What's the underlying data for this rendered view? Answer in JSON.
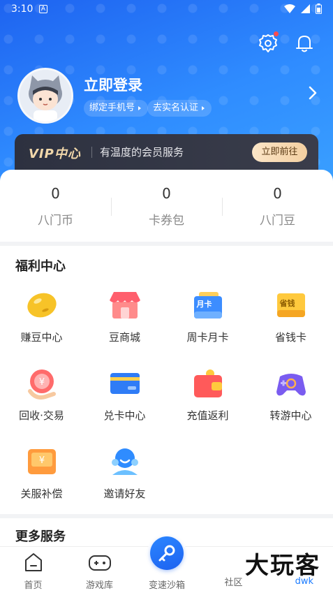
{
  "status_bar": {
    "time": "3:10",
    "a_badge": "A"
  },
  "header": {
    "login_title": "立即登录",
    "bind_phone": "绑定手机号",
    "verify_name": "去实名认证"
  },
  "vip": {
    "logo": "VIP中心",
    "slogan": "有温度的会员服务",
    "button": "立即前往"
  },
  "assets": [
    {
      "value": "0",
      "label": "八门币"
    },
    {
      "value": "0",
      "label": "卡券包"
    },
    {
      "value": "0",
      "label": "八门豆"
    }
  ],
  "welfare": {
    "title": "福利中心",
    "items": [
      {
        "label": "赚豆中心",
        "icon": "bean-icon"
      },
      {
        "label": "豆商城",
        "icon": "shop-icon"
      },
      {
        "label": "周卡月卡",
        "icon": "month-card-icon",
        "badge": "月卡"
      },
      {
        "label": "省钱卡",
        "icon": "save-card-icon",
        "badge": "省钱"
      },
      {
        "label": "回收·交易",
        "icon": "recycle-trade-icon"
      },
      {
        "label": "兑卡中心",
        "icon": "card-exchange-icon"
      },
      {
        "label": "充值返利",
        "icon": "wallet-icon"
      },
      {
        "label": "转游中心",
        "icon": "gamepad-icon"
      },
      {
        "label": "关服补偿",
        "icon": "compensation-icon"
      },
      {
        "label": "邀请好友",
        "icon": "invite-friend-icon"
      }
    ]
  },
  "more": {
    "title": "更多服务"
  },
  "tabbar": {
    "home": "首页",
    "game_library": "游戏库",
    "center": "变速沙箱",
    "community": "社区"
  },
  "watermark": {
    "text": "大玩客",
    "sub": "dwk"
  },
  "colors": {
    "primary": "#1e63f0",
    "vip_gold": "#f1d7aa",
    "dot_red": "#ff4d4f"
  }
}
